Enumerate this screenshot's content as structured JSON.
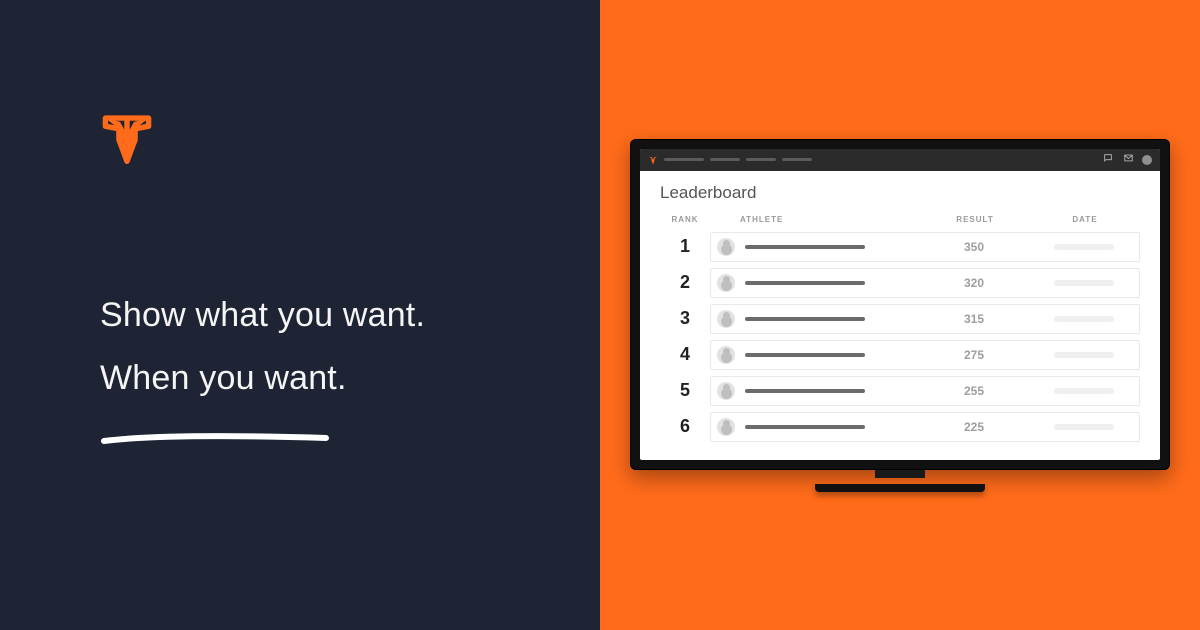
{
  "brand": {
    "accent": "#ff6b1a",
    "dark_bg": "#1e2433"
  },
  "hero": {
    "line1": "Show what you want.",
    "line2": "When you want."
  },
  "app": {
    "board_title": "Leaderboard",
    "columns": {
      "rank": "RANK",
      "athlete": "ATHLETE",
      "result": "RESULT",
      "date": "DATE"
    },
    "rows": [
      {
        "rank": "1",
        "result": "350"
      },
      {
        "rank": "2",
        "result": "320"
      },
      {
        "rank": "3",
        "result": "315"
      },
      {
        "rank": "4",
        "result": "275"
      },
      {
        "rank": "5",
        "result": "255"
      },
      {
        "rank": "6",
        "result": "225"
      }
    ],
    "topbar": {
      "icons": {
        "chat": "chat-icon",
        "mail": "mail-icon",
        "user": "user-avatar-icon"
      }
    }
  }
}
